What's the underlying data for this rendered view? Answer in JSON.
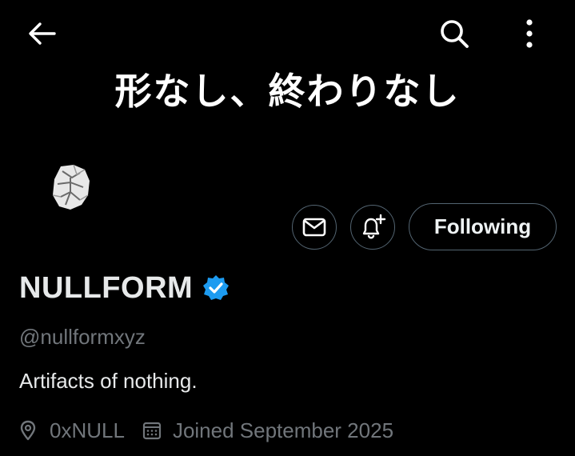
{
  "header": {
    "back_icon": "arrow-left-icon",
    "search_icon": "search-icon",
    "more_icon": "more-vertical-icon"
  },
  "banner": {
    "text": "形なし、終わりなし"
  },
  "actions": {
    "message_icon": "envelope-icon",
    "notify_icon": "bell-plus-icon",
    "follow_label": "Following"
  },
  "profile": {
    "name": "NULLFORM",
    "verified_icon": "verified-badge-icon",
    "handle": "@nullformxyz",
    "bio": "Artifacts of nothing.",
    "location": "0xNULL",
    "joined": "Joined September 2025"
  },
  "colors": {
    "background": "#000000",
    "text_primary": "#e7e9ea",
    "text_secondary": "#71767b",
    "border": "#536471",
    "verified": "#1d9bf0"
  }
}
